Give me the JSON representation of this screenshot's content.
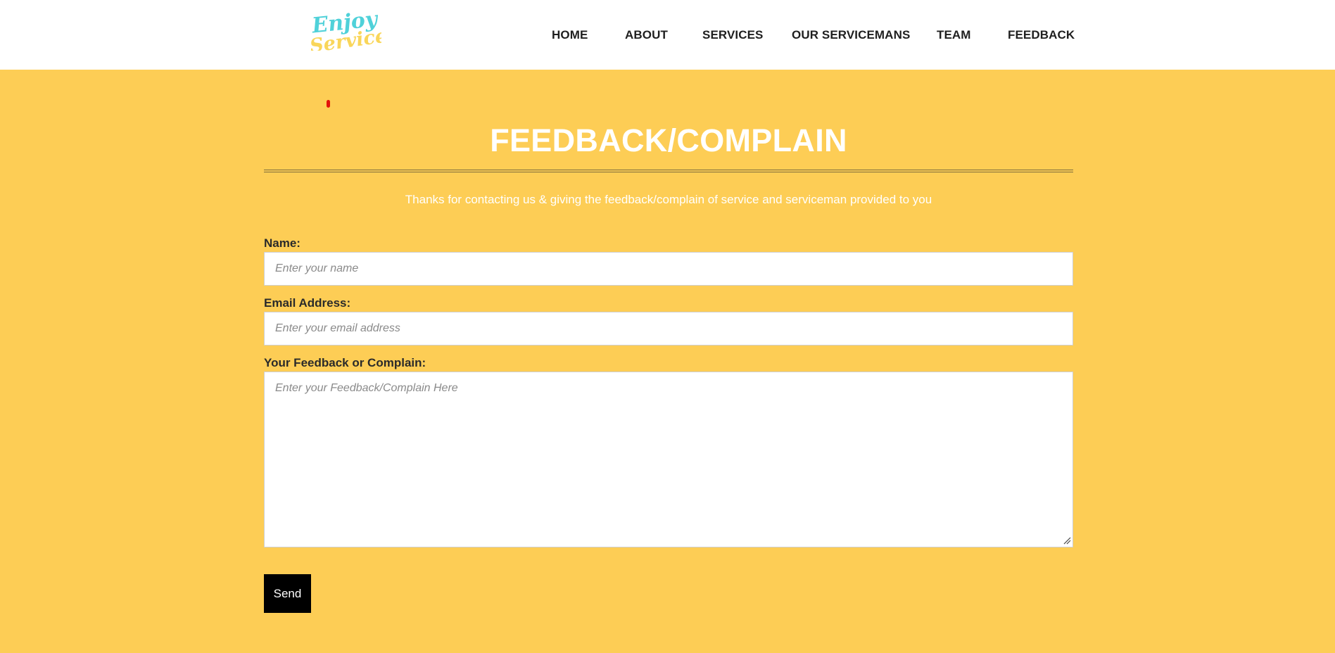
{
  "header": {
    "logo_icon": "enjoy-services-logo",
    "logo_text_top": "Enjoy",
    "logo_text_bottom": "Services",
    "nav": [
      {
        "label": "HOME"
      },
      {
        "label": "ABOUT"
      },
      {
        "label": "SERVICES"
      },
      {
        "label": "OUR SERVICEMANS"
      },
      {
        "label": "TEAM"
      },
      {
        "label": "FEEDBACK"
      }
    ]
  },
  "main": {
    "title": "FEEDBACK/COMPLAIN",
    "subtitle": "Thanks for contacting us & giving the feedback/complain of service and serviceman provided to you",
    "form": {
      "name_label": "Name:",
      "name_placeholder": "Enter your name",
      "email_label": "Email Address:",
      "email_placeholder": "Enter your email address",
      "feedback_label": "Your Feedback or Complain:",
      "feedback_placeholder": "Enter your Feedback/Complain Here",
      "send_label": "Send"
    }
  },
  "colors": {
    "background": "#fdcd55",
    "header_background": "#ffffff",
    "button_background": "#000000",
    "logo_teal": "#4fd1d9",
    "logo_yellow": "#f9d65a",
    "marker_red": "#e3120b"
  }
}
